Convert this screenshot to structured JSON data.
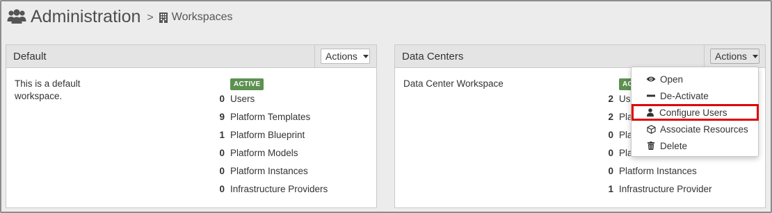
{
  "header": {
    "title": "Administration",
    "separator": ">",
    "breadcrumb": "Workspaces"
  },
  "panels": [
    {
      "title": "Default",
      "actions_label": "Actions",
      "description": "This is a default workspace.",
      "status": "ACTIVE",
      "stats": [
        {
          "count": "0",
          "label": "Users"
        },
        {
          "count": "9",
          "label": "Platform Templates"
        },
        {
          "count": "1",
          "label": "Platform Blueprint"
        },
        {
          "count": "0",
          "label": "Platform Models"
        },
        {
          "count": "0",
          "label": "Platform Instances"
        },
        {
          "count": "0",
          "label": "Infrastructure Providers"
        }
      ]
    },
    {
      "title": "Data Centers",
      "actions_label": "Actions",
      "description": "Data Center Workspace",
      "status": "AC",
      "stats": [
        {
          "count": "2",
          "label": "Use"
        },
        {
          "count": "2",
          "label": "Pla"
        },
        {
          "count": "0",
          "label": "Pla"
        },
        {
          "count": "0",
          "label": "Pla"
        },
        {
          "count": "0",
          "label": "Platform Instances"
        },
        {
          "count": "1",
          "label": "Infrastructure Provider"
        }
      ]
    }
  ],
  "actions_menu": [
    {
      "label": "Open",
      "icon": "eye-icon"
    },
    {
      "label": "De-Activate",
      "icon": "minus-icon"
    },
    {
      "label": "Configure Users",
      "icon": "user-icon",
      "highlighted": true
    },
    {
      "label": "Associate Resources",
      "icon": "cube-icon"
    },
    {
      "label": "Delete",
      "icon": "trash-icon"
    }
  ],
  "colors": {
    "badge": "#5c9151",
    "highlight_border": "#e00000",
    "panel_header": "#e4e4e4",
    "page_background": "#ececec"
  }
}
